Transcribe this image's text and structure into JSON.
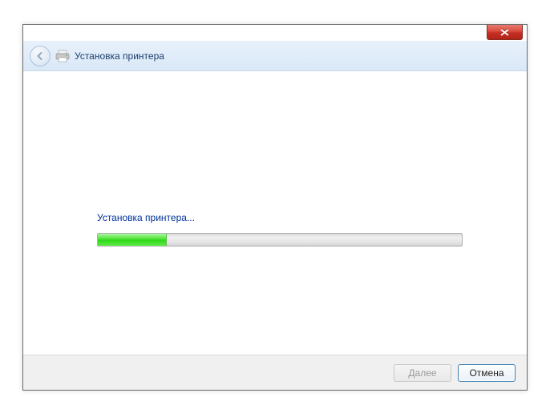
{
  "header": {
    "title": "Установка принтера"
  },
  "content": {
    "status_text": "Установка принтера...",
    "progress_percent": 19
  },
  "footer": {
    "next_label": "Далее",
    "cancel_label": "Отмена"
  }
}
